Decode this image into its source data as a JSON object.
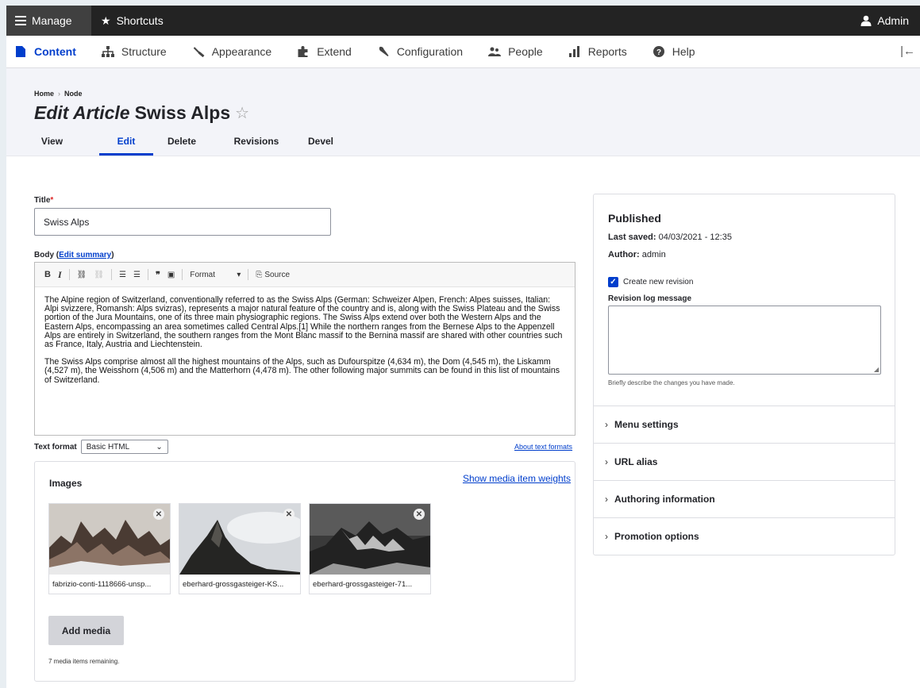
{
  "toolbar": {
    "manage": "Manage",
    "shortcuts": "Shortcuts",
    "user": "Admin"
  },
  "tray": {
    "items": [
      {
        "label": "Content",
        "icon": "document-icon"
      },
      {
        "label": "Structure",
        "icon": "sitemap-icon"
      },
      {
        "label": "Appearance",
        "icon": "brush-icon"
      },
      {
        "label": "Extend",
        "icon": "puzzle-icon"
      },
      {
        "label": "Configuration",
        "icon": "wrench-icon"
      },
      {
        "label": "People",
        "icon": "people-icon"
      },
      {
        "label": "Reports",
        "icon": "bar-chart-icon"
      },
      {
        "label": "Help",
        "icon": "help-icon"
      }
    ],
    "collapse": "|←"
  },
  "breadcrumb": [
    "Home",
    "Node"
  ],
  "page": {
    "title_kind": "Edit Article",
    "title_name": "Swiss Alps"
  },
  "tabs": [
    "View",
    "Edit",
    "Delete",
    "Revisions",
    "Devel"
  ],
  "form": {
    "title_label": "Title",
    "title_value": "Swiss Alps",
    "body_label": "Body",
    "edit_summary": "Edit summary",
    "toolbar": {
      "bold": "B",
      "italic": "I",
      "format": "Format",
      "source": "Source"
    },
    "body_paragraphs": [
      "The Alpine region of Switzerland, conventionally referred to as the Swiss Alps (German: Schweizer Alpen, French: Alpes suisses, Italian: Alpi svizzere, Romansh: Alps svizras), represents a major natural feature of the country and is, along with the Swiss Plateau and the Swiss portion of the Jura Mountains, one of its three main physiographic regions. The Swiss Alps extend over both the Western Alps and the Eastern Alps, encompassing an area sometimes called Central Alps.[1] While the northern ranges from the Bernese Alps to the Appenzell Alps are entirely in Switzerland, the southern ranges from the Mont Blanc massif to the Bernina massif are shared with other countries such as France, Italy, Austria and Liechtenstein.",
      "The Swiss Alps comprise almost all the highest mountains of the Alps, such as Dufourspitze (4,634 m), the Dom (4,545 m), the Liskamm (4,527 m), the Weisshorn (4,506 m) and the Matterhorn (4,478 m). The other following major summits can be found in this list of mountains of Switzerland."
    ],
    "text_format_label": "Text format",
    "text_format_value": "Basic HTML",
    "about_formats": "About text formats"
  },
  "images": {
    "title": "Images",
    "weights_link": "Show media item weights",
    "items": [
      {
        "name": "fabrizio-conti-1118666-unsp..."
      },
      {
        "name": "eberhard-grossgasteiger-KS..."
      },
      {
        "name": "eberhard-grossgasteiger-71..."
      }
    ],
    "add_button": "Add media",
    "remaining": "7 media items remaining."
  },
  "sidebar": {
    "status": "Published",
    "last_saved_label": "Last saved:",
    "last_saved_value": "04/03/2021 - 12:35",
    "author_label": "Author:",
    "author_value": "admin",
    "new_revision": "Create new revision",
    "revision_log_label": "Revision log message",
    "revision_desc": "Briefly describe the changes you have made.",
    "sections": [
      "Menu settings",
      "URL alias",
      "Authoring information",
      "Promotion options"
    ]
  },
  "colors": {
    "accent": "#003ecc",
    "toolbar_bg": "#232323",
    "header_bg": "#f3f4f9",
    "required": "#dc2323"
  }
}
